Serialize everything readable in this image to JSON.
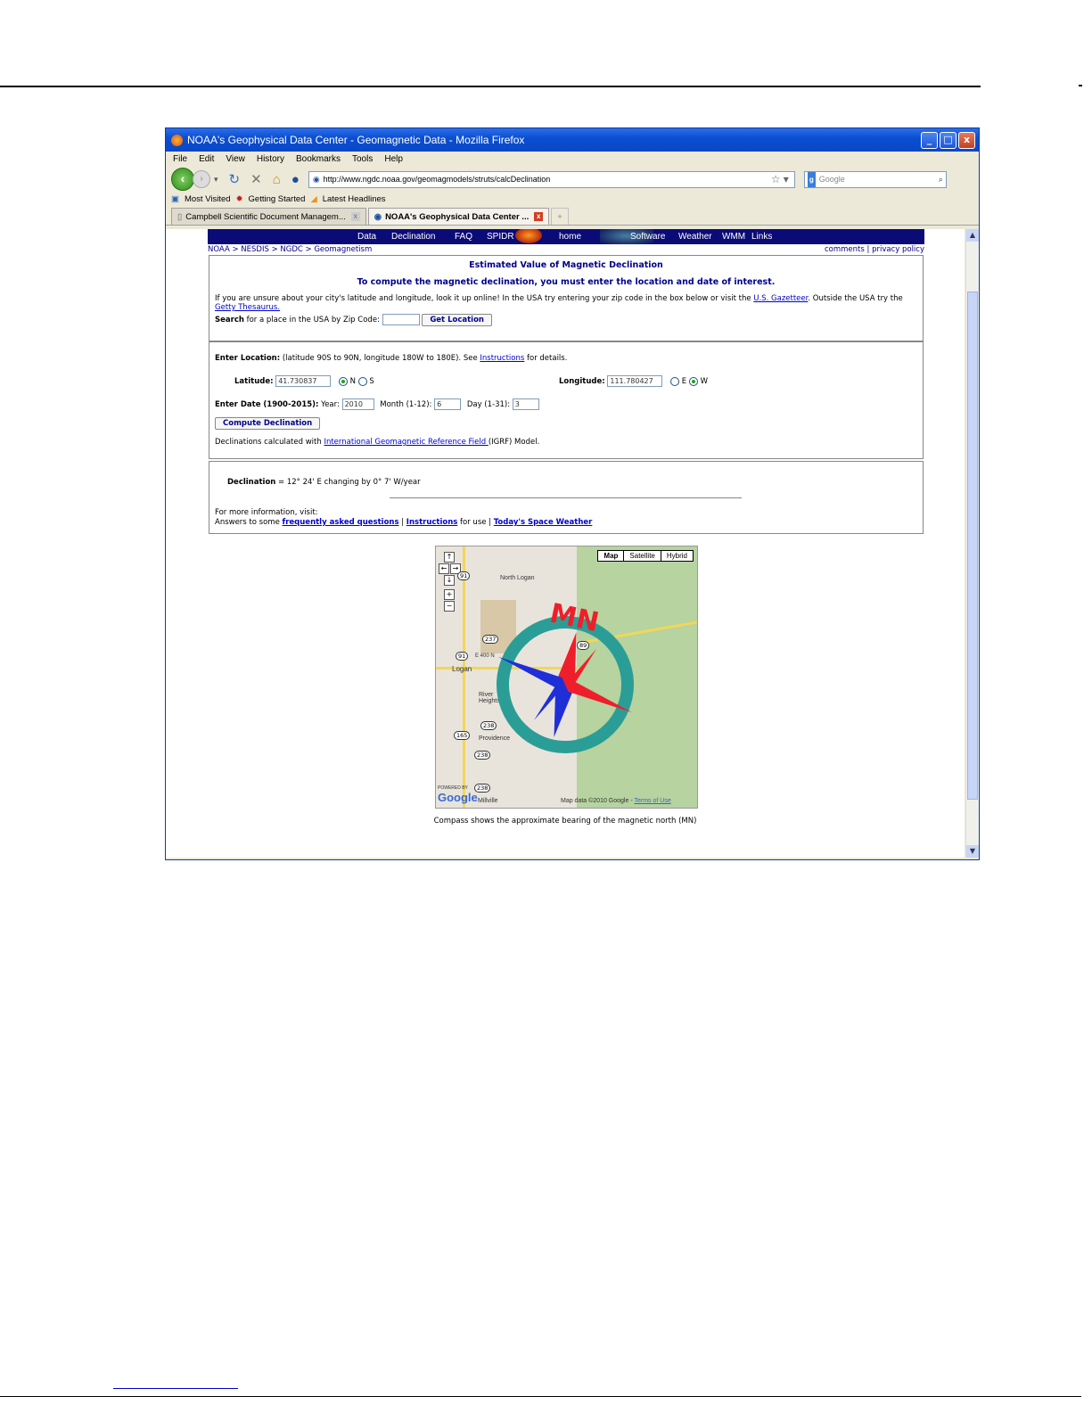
{
  "window": {
    "title": "NOAA's Geophysical Data Center - Geomagnetic Data - Mozilla Firefox",
    "controls": {
      "minimize": "_",
      "maximize": "□",
      "close": "x"
    }
  },
  "menu": [
    "File",
    "Edit",
    "View",
    "History",
    "Bookmarks",
    "Tools",
    "Help"
  ],
  "nav": {
    "url": "http://www.ngdc.noaa.gov/geomagmodels/struts/calcDeclination",
    "search_placeholder": "Google",
    "search_engine": "g"
  },
  "bookmarks": [
    "Most Visited",
    "Getting Started",
    "Latest Headlines"
  ],
  "tabs": [
    {
      "label": "Campbell Scientific Document Managem...",
      "active": false
    },
    {
      "label": "NOAA's Geophysical Data Center ...",
      "active": true
    }
  ],
  "site_nav": [
    "Data",
    "Declination",
    "FAQ",
    "SPIDR",
    "home",
    "Software",
    "Weather",
    "WMM",
    "Links"
  ],
  "breadcrumb": {
    "left": "NOAA > NESDIS > NGDC > Geomagnetism",
    "right": "comments |  privacy policy"
  },
  "intro": {
    "heading": "Estimated Value of Magnetic Declination",
    "subheading": "To compute the magnetic declination, you must enter the location and date of interest.",
    "text_a": "If you are unsure about your city's latitude and longitude, look it up online! In the USA try entering your zip code in the box below or visit the ",
    "link_gazetteer": "U.S. Gazetteer",
    "text_b": ". Outside the USA try the ",
    "link_getty": "Getty Thesaurus.",
    "search_bold": "Search",
    "search_text": " for a place in the USA by Zip Code:",
    "zip_value": "",
    "get_location": "Get Location"
  },
  "form": {
    "location_label": "Enter Location:",
    "location_text": " (latitude 90S to 90N, longitude 180W to 180E). See ",
    "instructions_link": "Instructions",
    "details_text": " for details.",
    "latitude_label": "Latitude:",
    "latitude_value": "41.730837",
    "lat_n": "N",
    "lat_s": "S",
    "longitude_label": "Longitude:",
    "longitude_value": "111.780427",
    "lon_e": "E",
    "lon_w": "W",
    "date_label": "Enter Date (1900-2015):",
    "year_label": " Year:",
    "year_value": "2010",
    "month_label": "Month (1-12):",
    "month_value": "6",
    "day_label": "Day (1-31):",
    "day_value": "3",
    "compute_button": "Compute Declination",
    "model_text_a": "Declinations calculated with ",
    "model_link": "International Geomagnetic Reference Field ",
    "model_text_b": "(IGRF) Model."
  },
  "result": {
    "declination_label": "Declination",
    "declination_value": " = 12° 24' E changing by 0° 7' W/year",
    "more_info": "For more information, visit:",
    "answers_text": "Answers to some ",
    "faq_link": "frequently asked questions",
    "sep1": " | ",
    "instructions_link": "Instructions",
    "for_use": " for use | ",
    "space_weather_link": "Today's Space Weather"
  },
  "map": {
    "buttons": [
      "Map",
      "Satellite",
      "Hybrid"
    ],
    "labels": [
      "North Logan",
      "Logan",
      "River Heights",
      "Providence",
      "Millville",
      "E 400 N"
    ],
    "shields": [
      "91",
      "237",
      "89",
      "91",
      "238",
      "165",
      "238",
      "238"
    ],
    "compass_label": "MN",
    "powered_by": "POWERED BY",
    "google": "Google",
    "map_data": "Map data ©2010 Google - ",
    "terms": "Terms of Use"
  },
  "caption": "Compass shows the approximate bearing of the magnetic north (MN)",
  "colors": {
    "noaa_bar": "#0b0b78",
    "link": "#0000cc",
    "titlebar": "#0a4fd2"
  }
}
